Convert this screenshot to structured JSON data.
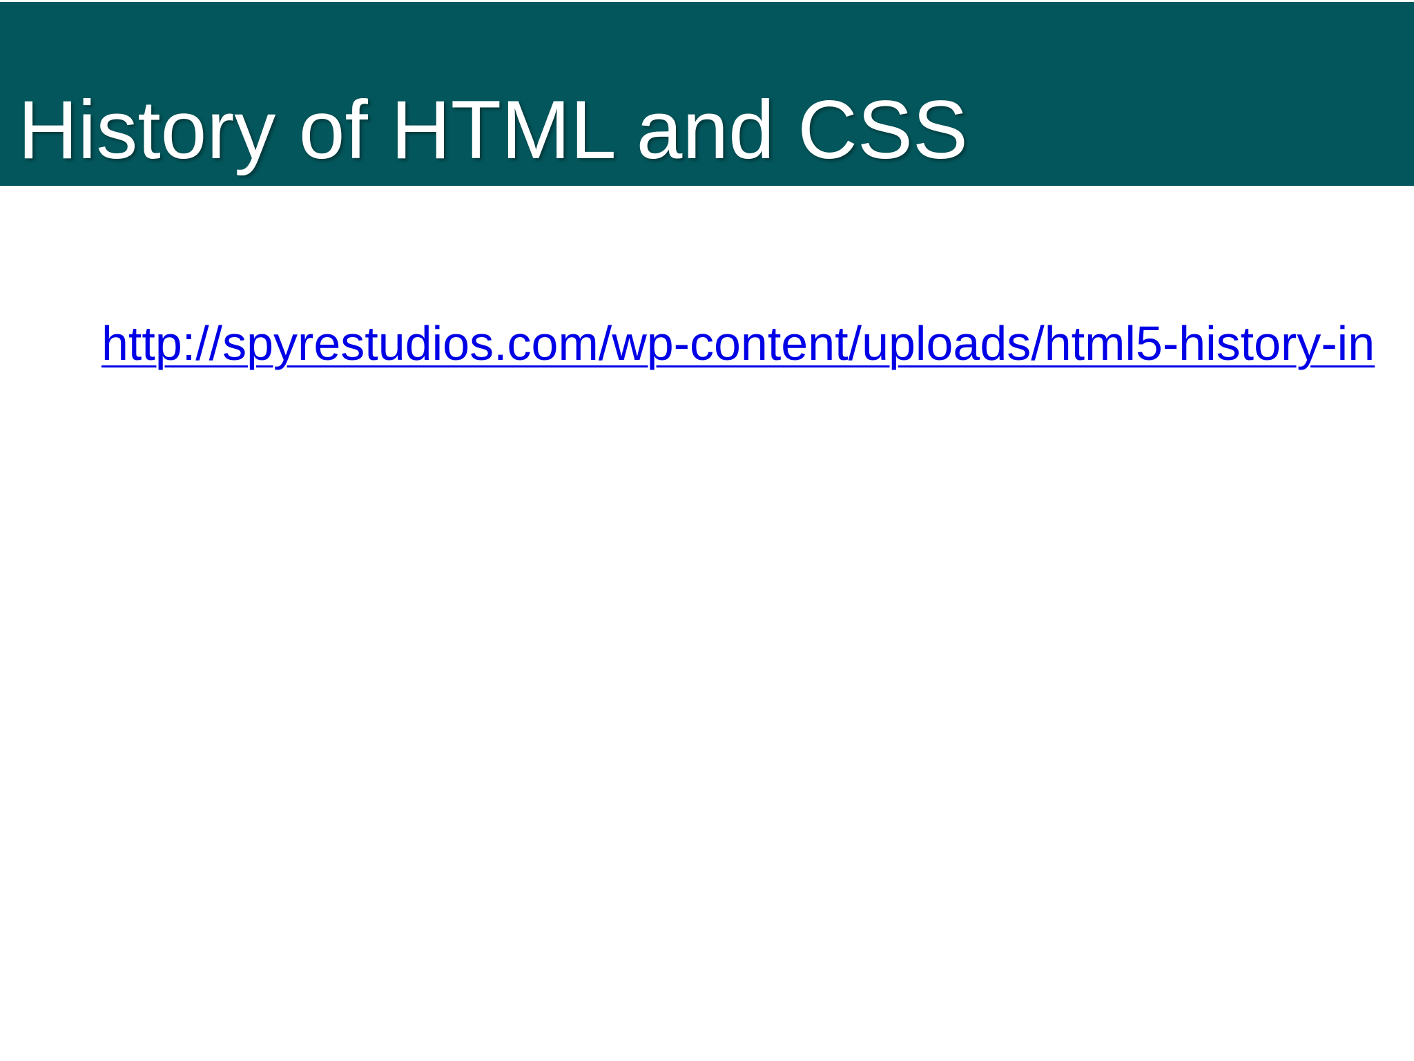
{
  "slide": {
    "title": "History of HTML and CSS",
    "link_text": "http://spyrestudios.com/wp-content/uploads/html5-history-in"
  },
  "colors": {
    "title_bar": "#03565b",
    "title_text": "#ffffff",
    "link": "#0000e6",
    "background": "#ffffff"
  }
}
